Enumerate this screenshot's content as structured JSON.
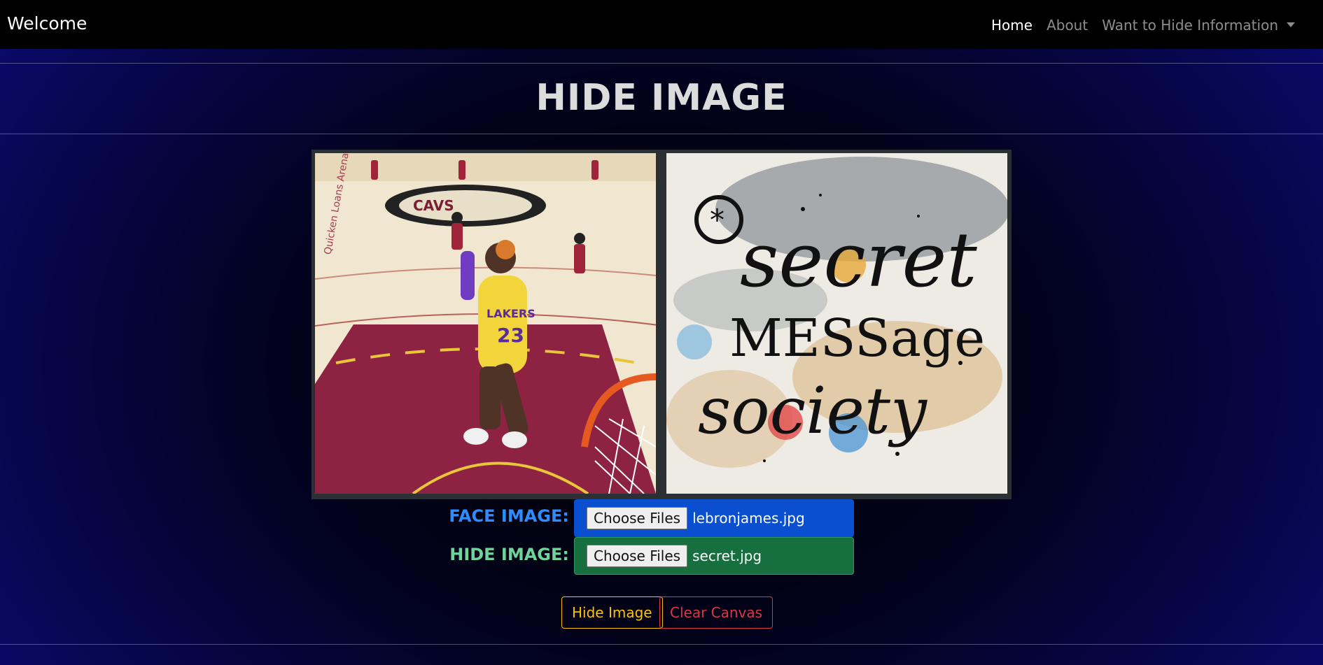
{
  "navbar": {
    "brand": "Welcome",
    "links": [
      {
        "label": "Home",
        "active": true
      },
      {
        "label": "About",
        "active": false
      },
      {
        "label": "Want to Hide Information",
        "active": false,
        "dropdown": true
      }
    ]
  },
  "page": {
    "title": "HIDE IMAGE"
  },
  "canvas": {
    "face_image_icon": "basketball-dunk-photo",
    "hide_image_icon": "secret-message-society-artwork",
    "face_art_text": "LAKERS 23",
    "hide_art_text": [
      "secret",
      "MESSage",
      "society"
    ]
  },
  "form": {
    "face_label": "FACE IMAGE:",
    "face_button": "Choose Files",
    "face_filename": "lebronjames.jpg",
    "hide_label": "HIDE IMAGE:",
    "hide_button": "Choose Files",
    "hide_filename": "secret.jpg"
  },
  "actions": {
    "hide_label": "Hide Image",
    "clear_label": "Clear Canvas"
  },
  "colors": {
    "face_accent": "#0b4fd1",
    "hide_accent": "#176f3f",
    "warning": "#ffc107",
    "danger": "#dc3545"
  }
}
